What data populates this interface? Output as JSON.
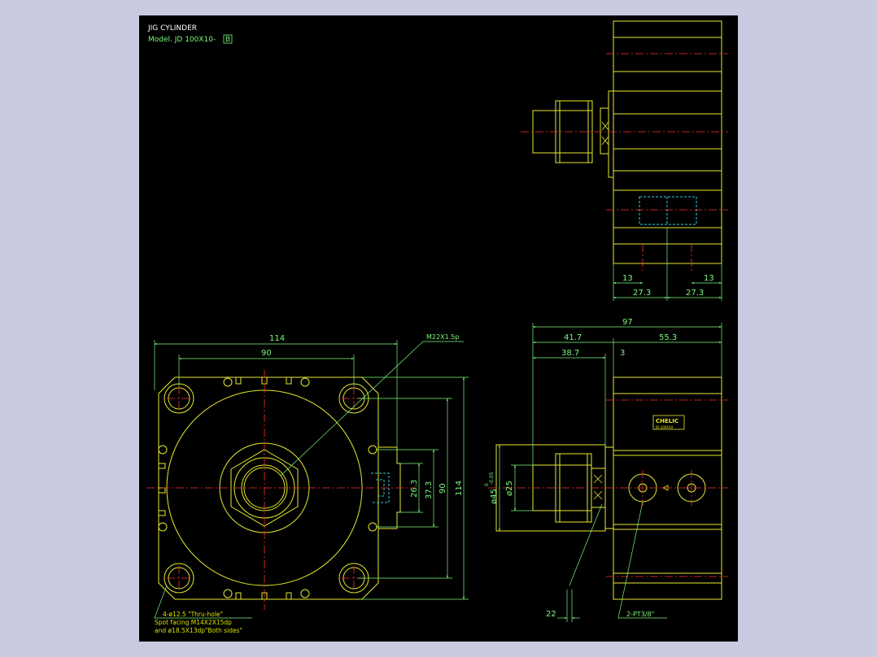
{
  "title": {
    "line1": "JIG CYLINDER",
    "line2_prefix": "Model.  JD 100X10-",
    "line2_boxed": "B"
  },
  "colors": {
    "outline": "#e8e830",
    "dimension": "#7cf87c",
    "centerline": "#ff3030",
    "hidden": "#30d0e8",
    "background": "#000000",
    "frame": "#c8cbe0"
  },
  "dimensions": {
    "front": {
      "overall_width": "114",
      "bolt_pitch_x": "90",
      "overall_height": "114",
      "bolt_pitch_y": "90",
      "port_pitch_small": "26.3",
      "port_pitch_large": "37.3",
      "thread_callout": "M22X1.5p"
    },
    "side": {
      "overall_length": "97",
      "body_left": "41.7",
      "body_right": "55.3",
      "rod_length": "38.7",
      "flange": "3",
      "rod_dia": "ø25",
      "piston_dia": "ø45",
      "piston_tol": "-0.05",
      "piston_tol_top": "0",
      "wrench_flat": "22",
      "port_note": "2-PT3/8\""
    },
    "top": {
      "left_offset": "13",
      "right_offset": "13",
      "left_half": "27.3",
      "right_half": "27.3"
    }
  },
  "notes": {
    "hole_line1": "4-ø12.5 \"Thru-hole\"",
    "hole_line2": "Spot facing   M14X2X15dp",
    "hole_line3": "and ø18.5X13dp\"Both sides\""
  },
  "label_plate": {
    "brand": "CHELIC",
    "sub": "JD-100X10"
  }
}
